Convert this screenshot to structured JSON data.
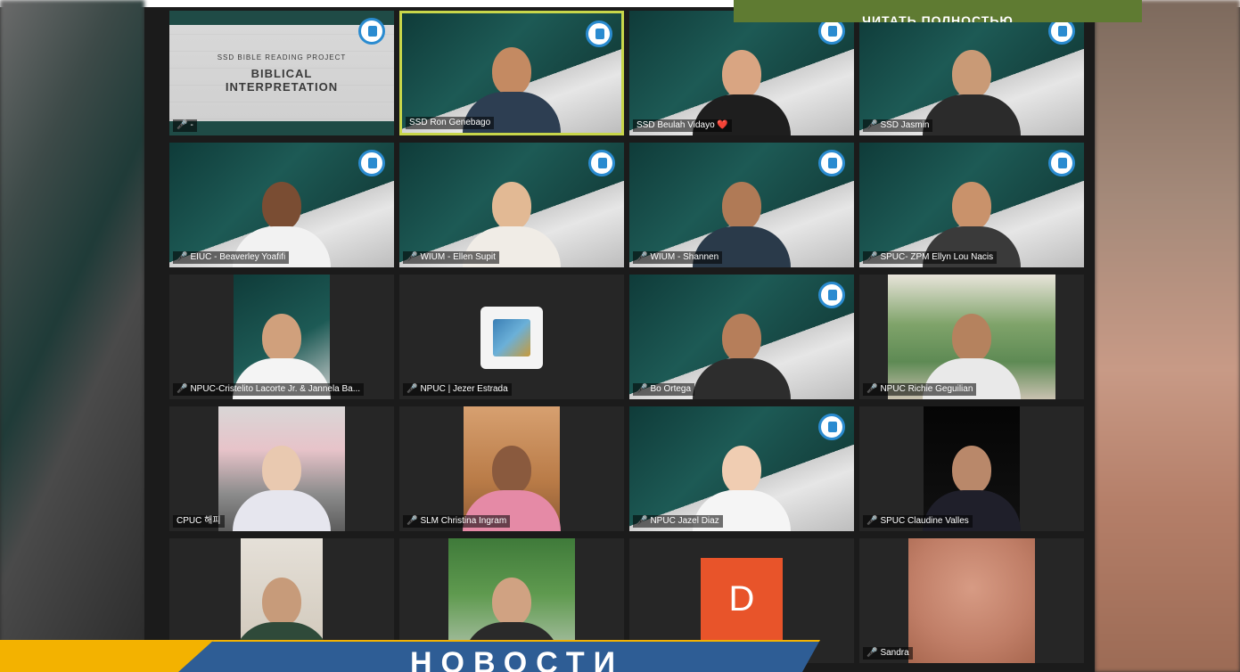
{
  "overlay_button": {
    "label": "ЧИТАТЬ ПОЛНОСТЬЮ"
  },
  "news_banner": {
    "label": "НОВОСТИ"
  },
  "slide": {
    "subtitle": "SSD BIBLE READING PROJECT",
    "title_line1": "BIBLICAL",
    "title_line2": "INTERPRETATION"
  },
  "participants": [
    {
      "name": "-",
      "kind": "slide",
      "muted": true
    },
    {
      "name": "SSD Ron Genebago",
      "kind": "church",
      "active": true,
      "muted": false,
      "skin": "#c48a62",
      "shirt": "#2d3e52"
    },
    {
      "name": "SSD Beulah Vidayo ❤️",
      "kind": "church",
      "muted": false,
      "skin": "#d9a582",
      "shirt": "#1e1e1e"
    },
    {
      "name": "SSD Jasmin",
      "kind": "church",
      "muted": true,
      "skin": "#c99a76",
      "shirt": "#2b2b2b"
    },
    {
      "name": "EIUC - Beaverley Yoafifi",
      "kind": "church",
      "muted": true,
      "skin": "#7a4d33",
      "shirt": "#f2f2f2"
    },
    {
      "name": "WIUM - Ellen Supit",
      "kind": "church",
      "muted": true,
      "skin": "#e2b994",
      "shirt": "#f0ece6"
    },
    {
      "name": "WIUM - Shannen",
      "kind": "church",
      "muted": true,
      "skin": "#b07a56",
      "shirt": "#2a3a4a"
    },
    {
      "name": "SPUC- ZPM Ellyn Lou Nacis",
      "kind": "church",
      "muted": true,
      "skin": "#c9926b",
      "shirt": "#3a3a3a"
    },
    {
      "name": "NPUC-Cristelito Lacorte Jr. & Jannela Ba...",
      "kind": "church-narrow",
      "muted": true,
      "skin": "#d0a07c",
      "shirt": "#f4f4f4"
    },
    {
      "name": "NPUC | Jezer Estrada",
      "kind": "thumb",
      "muted": true
    },
    {
      "name": "Bo Ortega",
      "kind": "church",
      "muted": true,
      "skin": "#b67e5a",
      "shirt": "#2d2d2d"
    },
    {
      "name": "NPUC Richie Geguilian",
      "kind": "room",
      "muted": true,
      "skin": "#b5825e",
      "shirt": "#e9e9e9"
    },
    {
      "name": "CPUC 해피",
      "kind": "street",
      "muted": false,
      "skin": "#e9c9b0",
      "shirt": "#e6e6ee"
    },
    {
      "name": "SLM Christina Ingram",
      "kind": "home",
      "muted": true,
      "skin": "#8a5a3e",
      "shirt": "#e58aa6"
    },
    {
      "name": "NPUC Jazel Diaz",
      "kind": "church",
      "muted": true,
      "skin": "#f0cdb2",
      "shirt": "#f5f5f5"
    },
    {
      "name": "SPUC Claudine Valles",
      "kind": "night",
      "muted": true,
      "skin": "#b9886a",
      "shirt": "#1f1f2a"
    },
    {
      "name": "",
      "kind": "studio",
      "muted": false,
      "skin": "#c79b7a",
      "shirt": "#2f4a3a"
    },
    {
      "name": "",
      "kind": "outdoor",
      "muted": false,
      "skin": "#d0a282",
      "shirt": "#2a2a2a"
    },
    {
      "name": "",
      "kind": "avatar",
      "letter": "D",
      "muted": false
    },
    {
      "name": "Sandra",
      "kind": "blur",
      "muted": true
    }
  ]
}
